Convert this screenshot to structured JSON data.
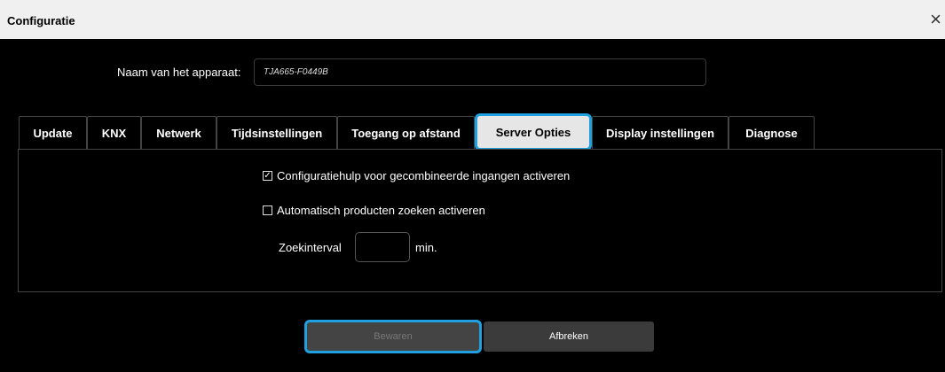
{
  "window": {
    "title": "Configuratie",
    "close_symbol": "×"
  },
  "device": {
    "label": "Naam van het apparaat:",
    "value": "TJA665-F0449B"
  },
  "tabs": [
    {
      "label": "Update"
    },
    {
      "label": "KNX"
    },
    {
      "label": "Netwerk"
    },
    {
      "label": "Tijdsinstellingen"
    },
    {
      "label": "Toegang op afstand"
    },
    {
      "label": "Server Opties",
      "active": true
    },
    {
      "label": "Display instellingen"
    },
    {
      "label": "Diagnose"
    }
  ],
  "options": {
    "config_help": {
      "label": "Configuratiehulp voor gecombineerde ingangen activeren",
      "checked": true,
      "mark": "✓"
    },
    "auto_search": {
      "label": "Automatisch producten zoeken activeren",
      "checked": false
    },
    "interval_label": "Zoekinterval",
    "interval_value": "",
    "interval_unit": "min."
  },
  "buttons": {
    "save": "Bewaren",
    "cancel": "Afbreken"
  },
  "colors": {
    "highlight": "#1fa0e0",
    "background": "#000000",
    "active_tab": "#e6e6e6"
  }
}
